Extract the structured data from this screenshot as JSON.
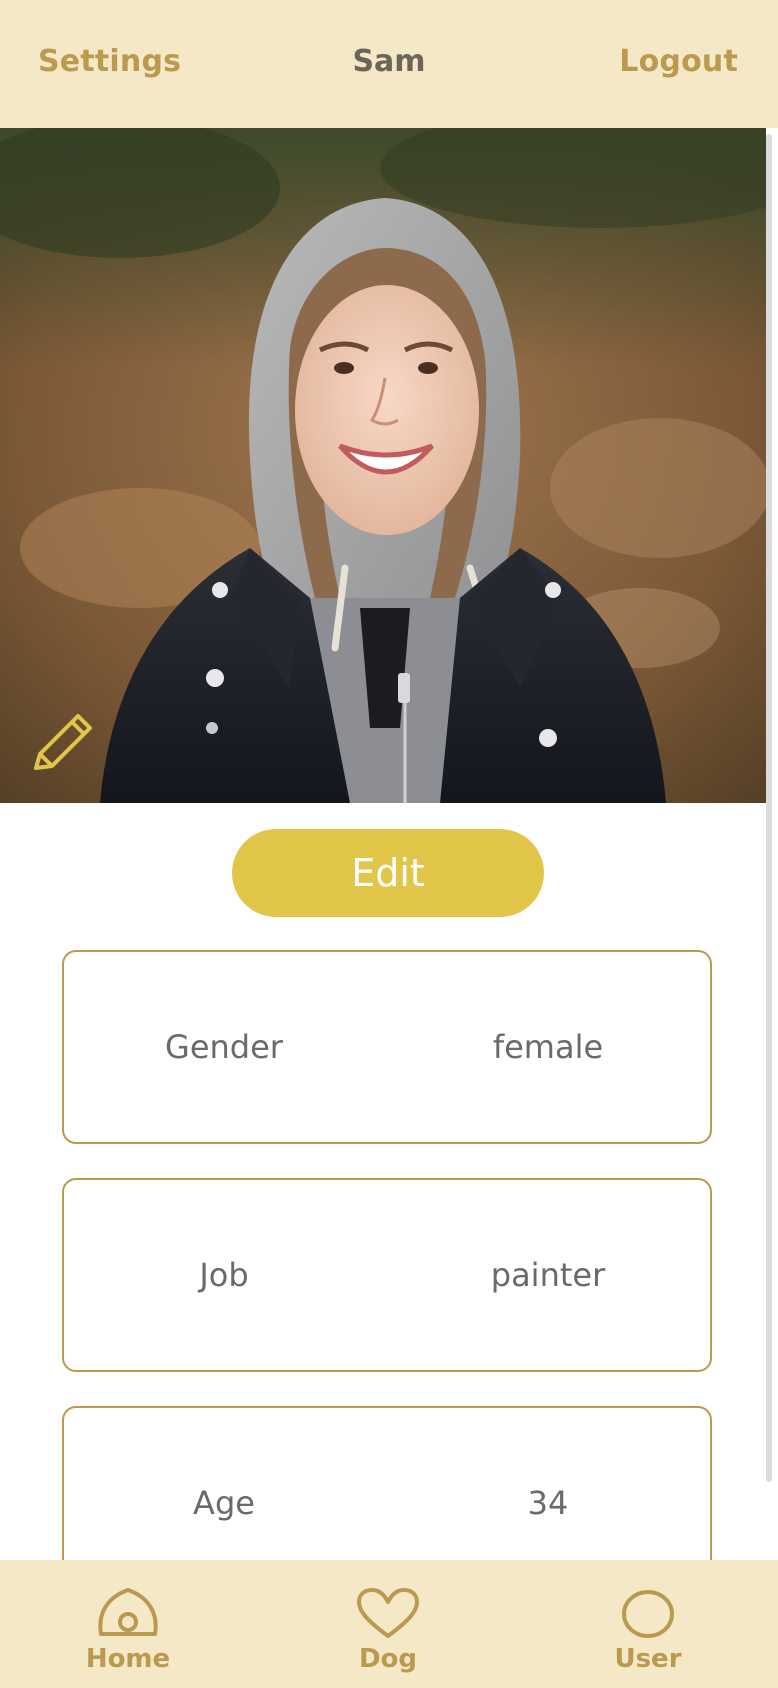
{
  "header": {
    "settings_label": "Settings",
    "title": "Sam",
    "logout_label": "Logout"
  },
  "profile": {
    "photo_alt": "profile photo",
    "edit_label": "Edit",
    "fields": [
      {
        "label": "Gender",
        "value": "female"
      },
      {
        "label": "Job",
        "value": "painter"
      },
      {
        "label": "Age",
        "value": "34"
      }
    ]
  },
  "bottom_nav": {
    "items": [
      {
        "label": "Home",
        "icon": "home-icon"
      },
      {
        "label": "Dog",
        "icon": "heart-icon"
      },
      {
        "label": "User",
        "icon": "user-circle-icon"
      }
    ]
  },
  "colors": {
    "accent": "#e1c64a",
    "brand": "#b99a4e",
    "bar_bg": "#f5e8c6"
  }
}
